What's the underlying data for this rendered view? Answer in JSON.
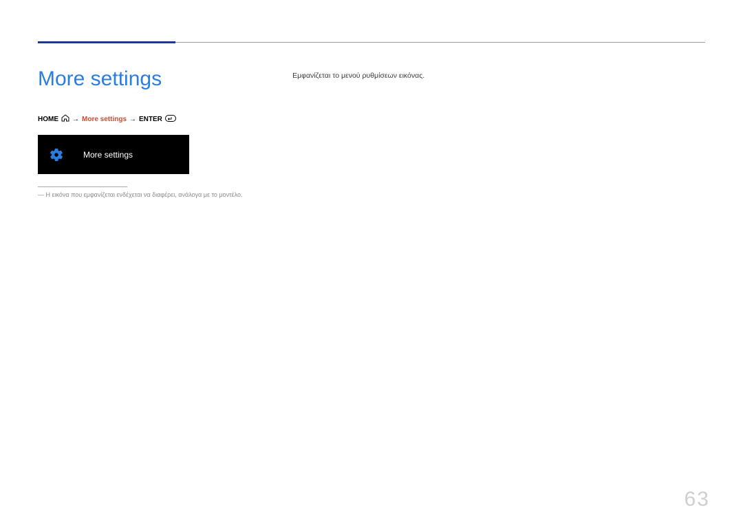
{
  "header": {
    "title": "More settings",
    "description": "Εμφανίζεται το μενού ρυθμίσεων εικόνας."
  },
  "breadcrumb": {
    "home_label": "HOME",
    "arrow": "→",
    "highlight": "More settings",
    "enter_label": "ENTER"
  },
  "menu": {
    "label": "More settings"
  },
  "footnote": {
    "prefix": "―",
    "text": "Η εικόνα που εμφανίζεται ενδέχεται να διαφέρει, ανάλογα με το μοντέλο."
  },
  "page_number": "63"
}
